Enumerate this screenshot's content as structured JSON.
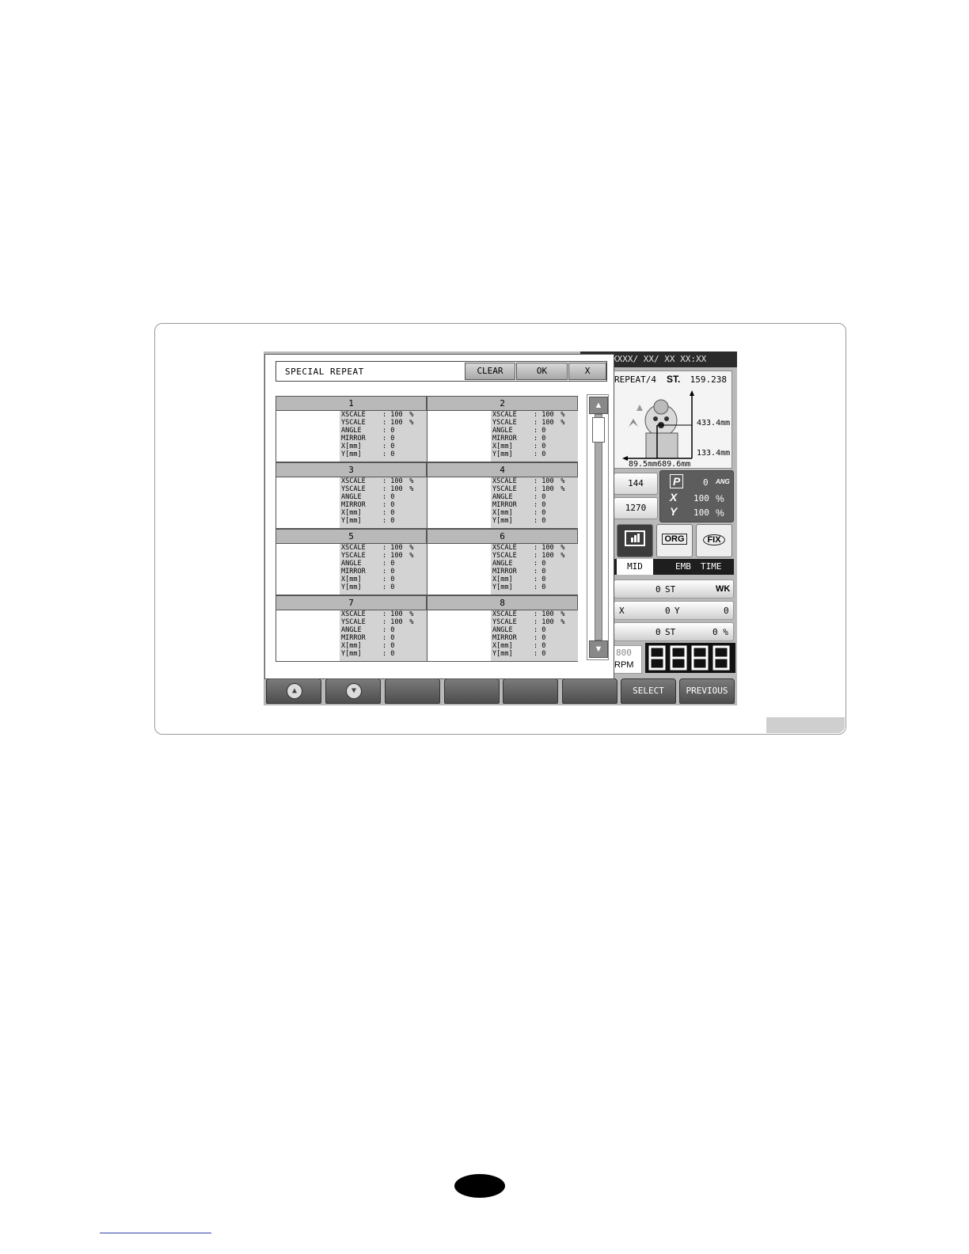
{
  "dialog": {
    "title": "SPECIAL  REPEAT",
    "clear_label": "CLEAR",
    "ok_label": "OK",
    "close_label": "X",
    "param_labels": [
      "XSCALE",
      "YSCALE",
      "ANGLE",
      "MIRROR",
      "X[mm]",
      "Y[mm]"
    ],
    "cells": [
      {
        "index": "1",
        "values": [
          "100",
          "100",
          "0",
          "0",
          "0",
          "0"
        ],
        "units": [
          "%",
          "%",
          "",
          "",
          "",
          ""
        ]
      },
      {
        "index": "2",
        "values": [
          "100",
          "100",
          "0",
          "0",
          "0",
          "0"
        ],
        "units": [
          "%",
          "%",
          "",
          "",
          "",
          ""
        ]
      },
      {
        "index": "3",
        "values": [
          "100",
          "100",
          "0",
          "0",
          "0",
          "0"
        ],
        "units": [
          "%",
          "%",
          "",
          "",
          "",
          ""
        ]
      },
      {
        "index": "4",
        "values": [
          "100",
          "100",
          "0",
          "0",
          "0",
          "0"
        ],
        "units": [
          "%",
          "%",
          "",
          "",
          "",
          ""
        ]
      },
      {
        "index": "5",
        "values": [
          "100",
          "100",
          "0",
          "0",
          "0",
          "0"
        ],
        "units": [
          "%",
          "%",
          "",
          "",
          "",
          ""
        ]
      },
      {
        "index": "6",
        "values": [
          "100",
          "100",
          "0",
          "0",
          "0",
          "0"
        ],
        "units": [
          "%",
          "%",
          "",
          "",
          "",
          ""
        ]
      },
      {
        "index": "7",
        "values": [
          "100",
          "100",
          "0",
          "0",
          "0",
          "0"
        ],
        "units": [
          "%",
          "%",
          "",
          "",
          "",
          ""
        ]
      },
      {
        "index": "8",
        "values": [
          "100",
          "100",
          "0",
          "0",
          "0",
          "0"
        ],
        "units": [
          "%",
          "%",
          "",
          "",
          "",
          ""
        ]
      }
    ]
  },
  "right_panel": {
    "datetime": "XXXX/ XX/ XX  XX:XX",
    "repeat_label": "REPEAT/4",
    "st_label": "ST.",
    "st_value": "159.238",
    "dim_top": "433.4mm",
    "dim_mid": "133.4mm",
    "dim_bottom": "89.5mm689.6mm",
    "count_1": "144",
    "count_2": "1270",
    "p_label": "P",
    "x_label": "X",
    "y_label": "Y",
    "p_value": "0",
    "p_unit": "ANG",
    "x_value": "100",
    "x_unit": "%",
    "y_value": "100",
    "y_unit": "%",
    "org_label": "ORG",
    "fix_label": "FIX",
    "status_mid": "MID",
    "status_emb": "EMB",
    "status_time": "TIME",
    "row1_val": "0",
    "row1_st": "ST",
    "row1_wk": "WK",
    "row2_x": "X",
    "row2_xval": "0",
    "row2_y": "Y",
    "row2_yval": "0",
    "row3_val": "0",
    "row3_st": "ST",
    "row3_pct": "0 %",
    "rpm_value": "800",
    "rpm_unit": "RPM"
  },
  "footer": {
    "up_icon": "up-arrow-icon",
    "down_icon": "down-arrow-icon",
    "select_label": "SELECT",
    "previous_label": "PREVIOUS"
  }
}
